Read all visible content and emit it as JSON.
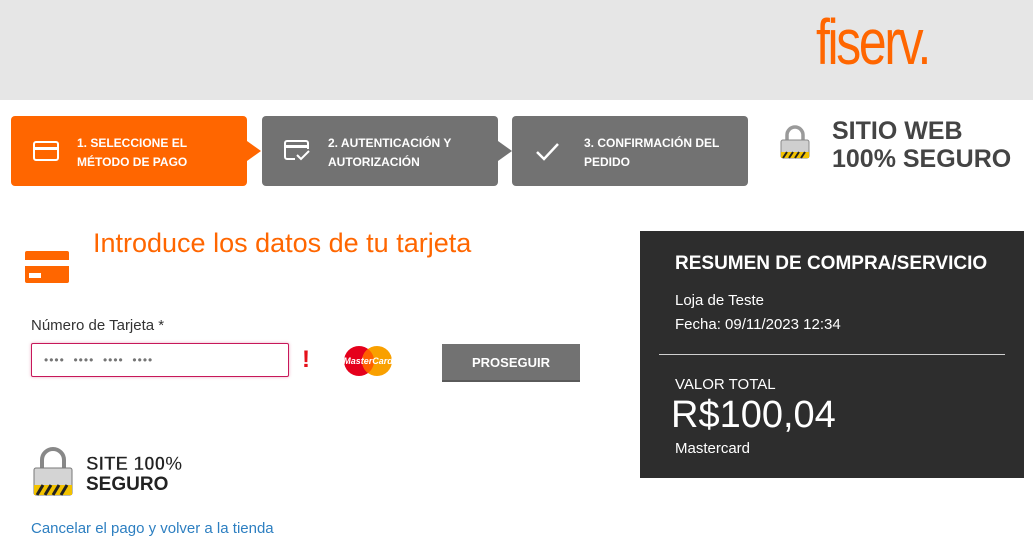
{
  "brand": {
    "logo_text": "fiserv.",
    "accent": "#ff6600"
  },
  "steps": [
    {
      "label": "1. Seleccione el método de pago",
      "icon": "card-icon",
      "active": true
    },
    {
      "label": "2. Autenticación y autorización",
      "icon": "card-check-icon",
      "active": false
    },
    {
      "label": "3. Confirmación del pedido",
      "icon": "checkmark-icon",
      "active": false
    }
  ],
  "secure_header": {
    "text": "SITIO WEB 100% SEGURO",
    "icon": "padlock-icon"
  },
  "form": {
    "title": "Introduce los datos de tu tarjeta",
    "card_label": "Número de Tarjeta *",
    "card_placeholder": "••••  ••••  ••••  ••••",
    "card_value": "",
    "error_mark": "!",
    "card_brand": "MasterCard",
    "submit_label": "PROSEGUIR"
  },
  "secure_badge": {
    "line1": "SITE 100%",
    "line2": "SEGURO"
  },
  "cancel_link": "Cancelar el pago y volver a la tienda",
  "summary": {
    "title": "RESUMEN DE COMPRA/SERVICIO",
    "store": "Loja de Teste",
    "date": "Fecha: 09/11/2023 12:34",
    "total_label": "VALOR TOTAL",
    "total": "R$100,04",
    "payment_brand": "Mastercard"
  }
}
